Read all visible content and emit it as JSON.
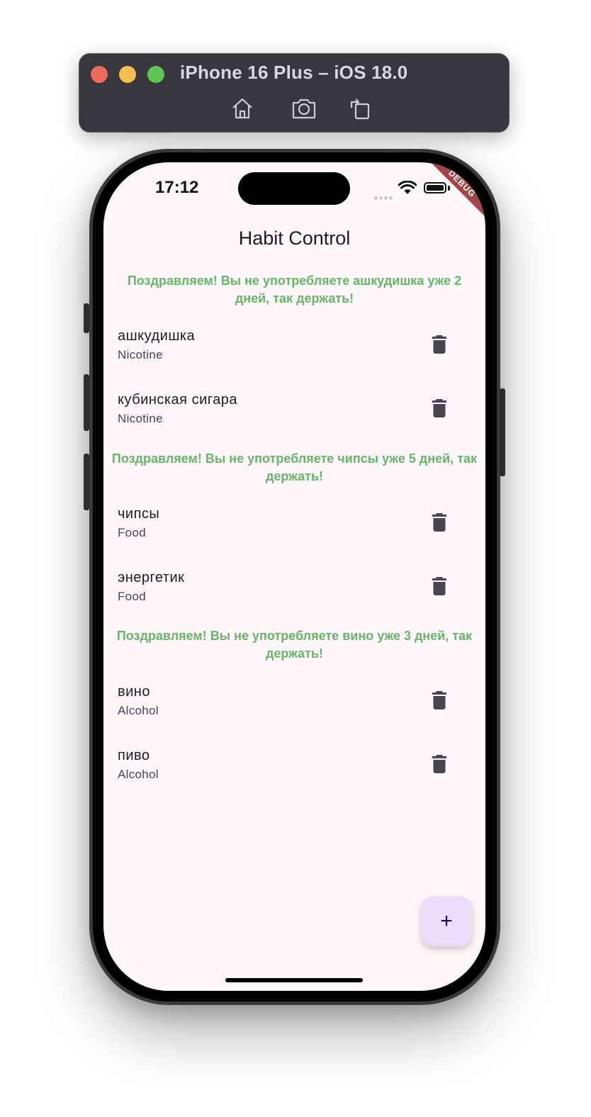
{
  "simulator": {
    "title": "iPhone 16 Plus – iOS 18.0",
    "buttons": [
      "home-icon",
      "screenshot-icon",
      "rotate-icon"
    ]
  },
  "status_bar": {
    "time": "17:12"
  },
  "debug_banner": "DEBUG",
  "app": {
    "title": "Habit Control",
    "groups": [
      {
        "message": "Поздравляем! Вы не употребляете ашкудишка уже 2 дней, так держать!",
        "habits": [
          {
            "name": "ашкудишка",
            "category": "Nicotine"
          },
          {
            "name": "кубинская сигара",
            "category": "Nicotine"
          }
        ]
      },
      {
        "message": "Поздравляем! Вы не употребляете чипсы уже 5 дней, так держать!",
        "habits": [
          {
            "name": "чипсы",
            "category": "Food"
          },
          {
            "name": "энергетик",
            "category": "Food"
          }
        ]
      },
      {
        "message": "Поздравляем! Вы не употребляете вино уже 3 дней, так держать!",
        "habits": [
          {
            "name": "вино",
            "category": "Alcohol"
          },
          {
            "name": "пиво",
            "category": "Alcohol"
          }
        ]
      }
    ],
    "fab_label": "+"
  },
  "colors": {
    "success_text": "#6ab368",
    "screen_bg": "#fcf7fb",
    "fab_bg": "#e8defa",
    "debug_ribbon": "#a04646"
  }
}
